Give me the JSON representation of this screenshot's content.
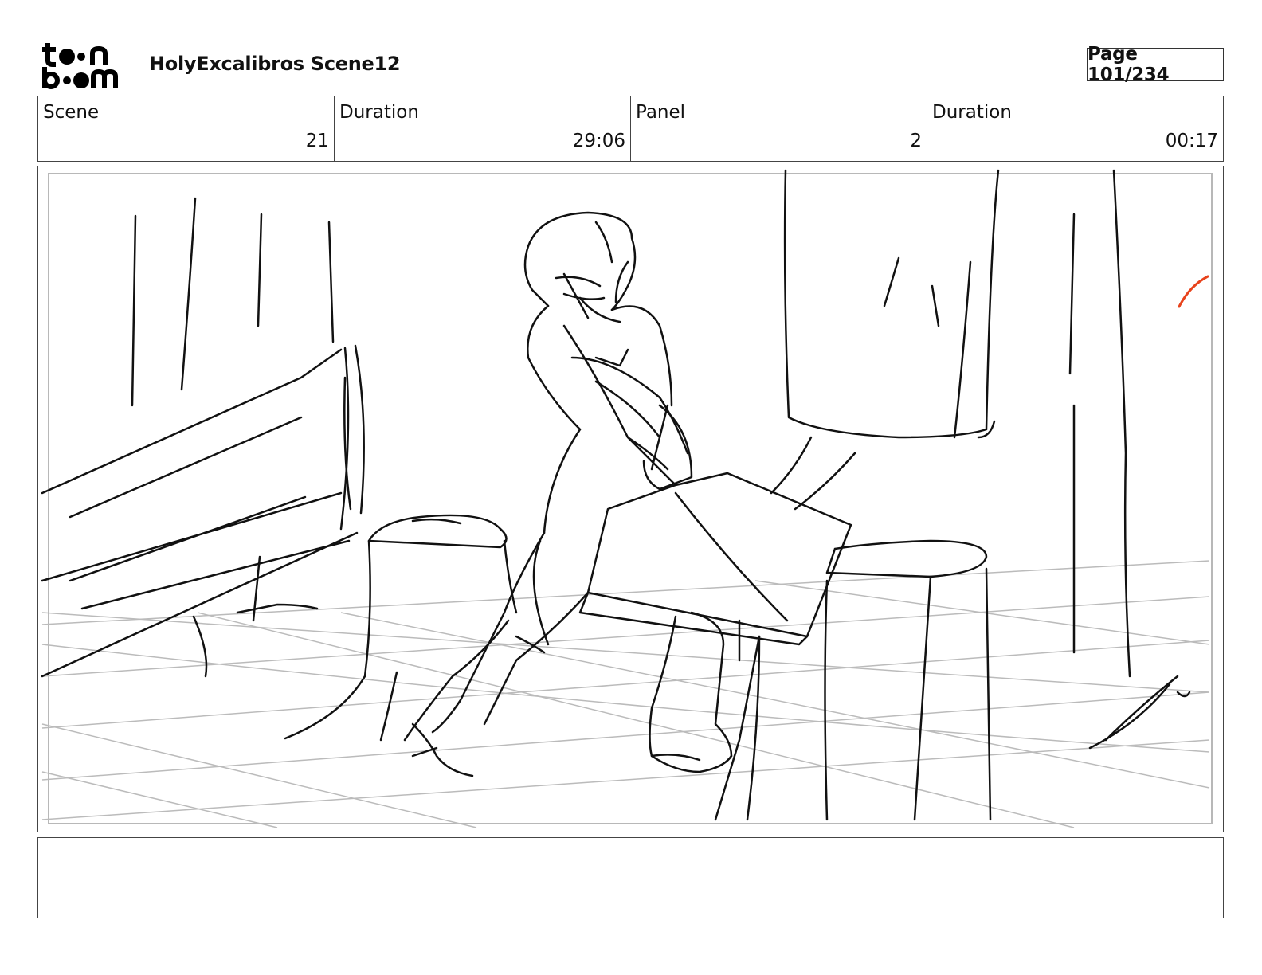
{
  "header": {
    "logo": {
      "line1": "t••n",
      "line2": "b••m",
      "name": "toonboom-logo"
    },
    "project_title": "HolyExcalibros Scene12",
    "page_label": "Page 101/234"
  },
  "info": {
    "scene_label": "Scene",
    "scene_value": "21",
    "scene_duration_label": "Duration",
    "scene_duration_value": "29:06",
    "panel_label": "Panel",
    "panel_value": "2",
    "panel_duration_label": "Duration",
    "panel_duration_value": "00:17"
  },
  "panel": {
    "image": "storyboard-sketch-character-swinging-sword",
    "accent_mark_color": "#e8431c"
  },
  "notes": {
    "text": ""
  }
}
